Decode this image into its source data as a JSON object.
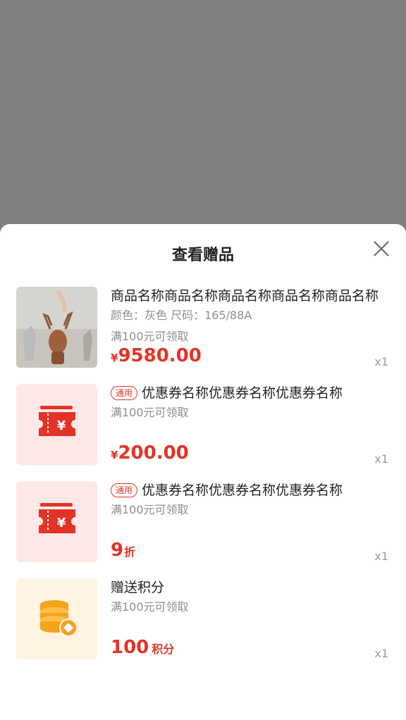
{
  "sheet": {
    "title": "查看赠品"
  },
  "items": [
    {
      "name": "商品名称商品名称商品名称商品名称商品名称",
      "spec": "颜色：灰色   尺码：165/88A",
      "condition": "满100元可领取",
      "price_symbol": "¥",
      "price": "9580.00",
      "qty": "x1",
      "thumb_icon": "deer-figurine-photo"
    },
    {
      "tag": "通用",
      "name": "优惠券名称优惠券名称优惠券名称",
      "condition": "满100元可领取",
      "price_symbol": "¥",
      "price": "200.00",
      "qty": "x1",
      "thumb_icon": "coupon-ticket-icon",
      "thumb_bg": "#fde8e8"
    },
    {
      "tag": "通用",
      "name": "优惠券名称优惠券名称优惠券名称",
      "condition": "满100元可领取",
      "price": "9",
      "price_unit": "折",
      "qty": "x1",
      "thumb_icon": "coupon-ticket-icon",
      "thumb_bg": "#fde8e8"
    },
    {
      "name": "赠送积分",
      "condition": "满100元可领取",
      "price": "100",
      "price_unit": "积分",
      "qty": "x1",
      "thumb_icon": "coins-points-icon",
      "thumb_bg": "#fff3e3"
    }
  ],
  "colors": {
    "accent": "#e33326",
    "coin": "#f7a21b"
  }
}
